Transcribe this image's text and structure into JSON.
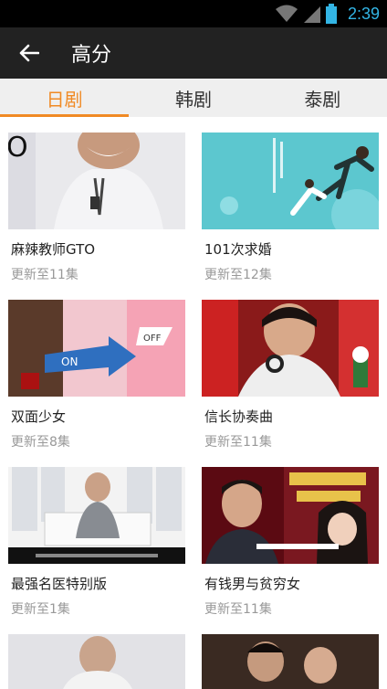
{
  "status": {
    "time": "2:39"
  },
  "header": {
    "title": "高分"
  },
  "tabs": [
    {
      "label": "日剧",
      "active": true
    },
    {
      "label": "韩剧",
      "active": false
    },
    {
      "label": "泰剧",
      "active": false
    }
  ],
  "items": [
    {
      "title": "麻辣教师GTO",
      "subtitle": "更新至11集"
    },
    {
      "title": "101次求婚",
      "subtitle": "更新至12集"
    },
    {
      "title": "双面少女",
      "subtitle": "更新至8集"
    },
    {
      "title": "信长协奏曲",
      "subtitle": "更新至11集"
    },
    {
      "title": "最强名医特别版",
      "subtitle": "更新至1集"
    },
    {
      "title": "有钱男与贫穷女",
      "subtitle": "更新至11集"
    }
  ],
  "colors": {
    "accent": "#f08a24",
    "appbar": "#222222",
    "status_time": "#33b5e5"
  }
}
